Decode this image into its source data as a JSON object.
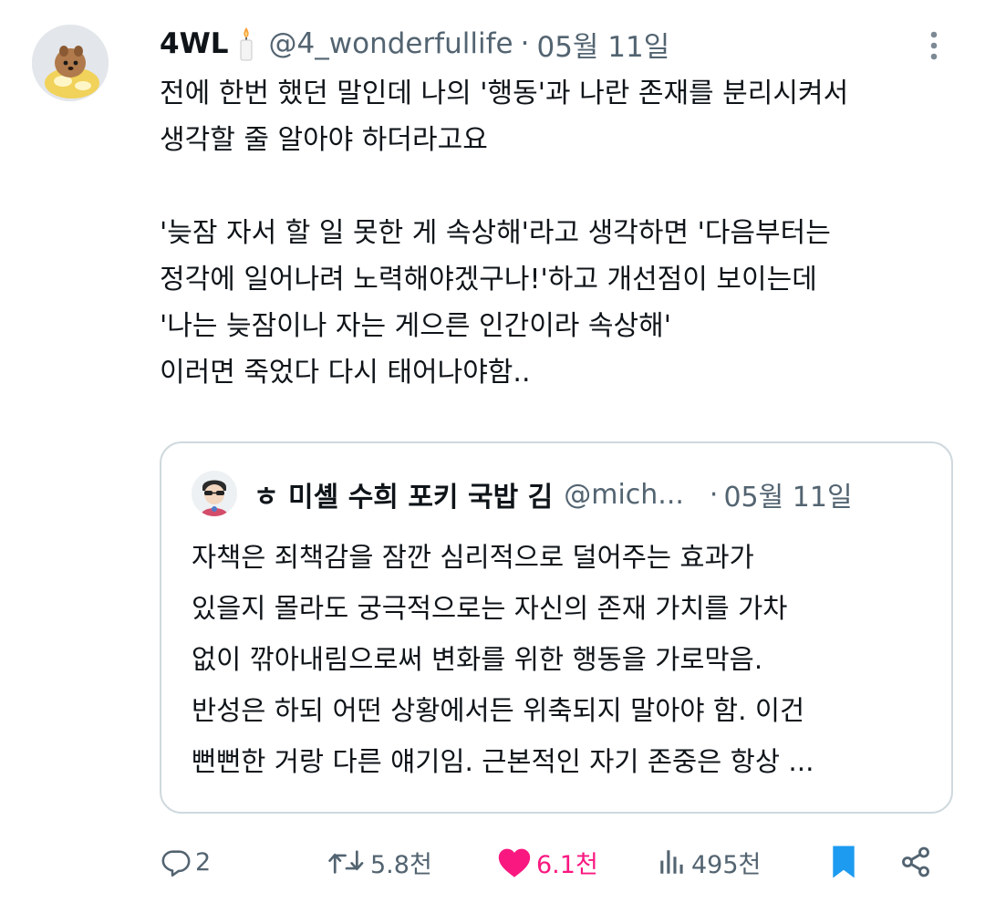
{
  "tweet": {
    "display_name": "4WL",
    "name_emoji": "candle-icon",
    "handle": "@4_wonderfullife",
    "separator": "·",
    "date": "05월 11일",
    "text": "전에 한번 했던 말인데 나의 '행동'과 나란 존재를 분리시켜서\n생각할 줄 알아야 하더라고요\n\n'늦잠 자서 할 일 못한 게 속상해'라고 생각하면 '다음부터는\n정각에 일어나려 노력해야겠구나!'하고 개선점이 보이는데\n'나는 늦잠이나 자는 게으른 인간이라 속상해'\n이러면 죽었다 다시 태어나야함.."
  },
  "quote": {
    "display_name": "ㅎ 미셸 수희 포키 국밥 김",
    "handle": "@mich...",
    "separator": "·",
    "date": "05월 11일",
    "text": "자책은 죄책감을 잠깐 심리적으로 덜어주는 효과가\n있을지 몰라도 궁극적으로는 자신의 존재 가치를 가차\n없이 깎아내림으로써 변화를 위한 행동을 가로막음.\n반성은 하되 어떤 상황에서든 위축되지 말아야 함. 이건\n뻔뻔한 거랑 다른 얘기임. 근본적인 자기 존중은 항상 ..."
  },
  "actions": {
    "replies": "2",
    "retweets": "5.8천",
    "likes": "6.1천",
    "views": "495천",
    "liked": true,
    "bookmarked": true
  },
  "colors": {
    "text": "#0f1419",
    "secondary": "#536471",
    "border": "#cfd9de",
    "like": "#f91880",
    "bookmark": "#1d9bf0"
  }
}
